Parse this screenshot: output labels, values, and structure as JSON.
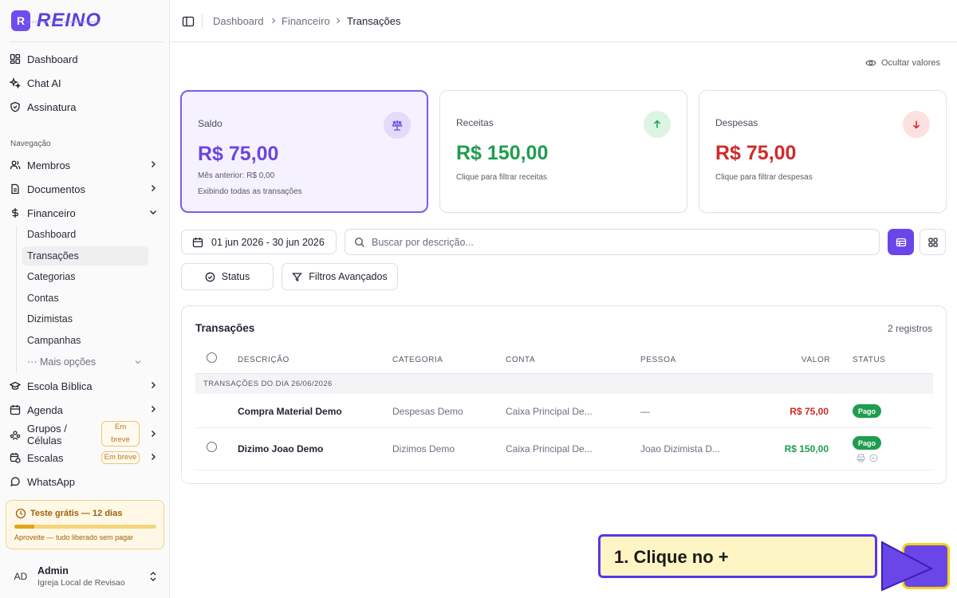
{
  "brand": {
    "name": "REINO",
    "tagline": "GESTÃO DE IGREJAS PARA PASTORES",
    "mark": "R"
  },
  "sidebar": {
    "top_items": [
      {
        "label": "Dashboard",
        "icon": "grid-icon"
      },
      {
        "label": "Chat AI",
        "icon": "sparkles-icon"
      },
      {
        "label": "Assinatura",
        "icon": "shield-icon"
      }
    ],
    "section_label": "Navegação",
    "items": [
      {
        "label": "Membros",
        "icon": "users-icon"
      },
      {
        "label": "Documentos",
        "icon": "file-icon"
      },
      {
        "label": "Financeiro",
        "icon": "dollar-icon"
      }
    ],
    "financeiro_sub": [
      "Dashboard",
      "Transações",
      "Categorias",
      "Contas",
      "Dizimistas",
      "Campanhas"
    ],
    "more_options": "··· Mais opções",
    "lower_items": [
      {
        "label": "Escola Bíblica",
        "icon": "graduation-cap-icon"
      },
      {
        "label": "Agenda",
        "icon": "calendar-icon"
      },
      {
        "label": "Grupos / Células",
        "icon": "group-icon",
        "badge": "Em breve"
      },
      {
        "label": "Escalas",
        "icon": "calendar-clock-icon",
        "badge": "Em breve"
      },
      {
        "label": "WhatsApp",
        "icon": "whatsapp-icon"
      }
    ],
    "trial": {
      "title": "Teste grátis — 12 dias",
      "note": "Aproveite — tudo liberado sem pagar",
      "progress": 0.14
    },
    "user": {
      "initials": "AD",
      "name": "Admin",
      "org": "Igreja Local de Revisao"
    }
  },
  "header": {
    "breadcrumb": [
      "Dashboard",
      "Financeiro",
      "Transações"
    ]
  },
  "hide_values_label": "Ocultar valores",
  "cards": {
    "saldo": {
      "label": "Saldo",
      "value": "R$ 75,00",
      "sub": "Mês anterior: R$ 0,00",
      "sub2": "Exibindo todas as transações"
    },
    "receitas": {
      "label": "Receitas",
      "value": "R$ 150,00",
      "sub": "Clique para filtrar receitas"
    },
    "despesas": {
      "label": "Despesas",
      "value": "R$ 75,00",
      "sub": "Clique para filtrar despesas"
    }
  },
  "filters": {
    "date_range": "01 jun 2026 - 30 jun 2026",
    "search_placeholder": "Buscar por descrição...",
    "status_label": "Status",
    "advanced_label": "Filtros Avançados"
  },
  "table": {
    "title": "Transações",
    "count": "2 registros",
    "columns": [
      "DESCRIÇÃO",
      "CATEGORIA",
      "CONTA",
      "PESSOA",
      "VALOR",
      "STATUS"
    ],
    "group_label": "TRANSAÇÕES DO DIA 26/06/2026",
    "rows": [
      {
        "descricao": "Compra Material Demo",
        "categoria": "Despesas Demo",
        "conta": "Caixa Principal De...",
        "pessoa": "—",
        "valor": "R$ 75,00",
        "status": "Pago",
        "type": "expense"
      },
      {
        "descricao": "Dizimo Joao Demo",
        "categoria": "Dizimos Demo",
        "conta": "Caixa Principal De...",
        "pessoa": "Joao Dizimista D...",
        "valor": "R$ 150,00",
        "status": "Pago",
        "type": "income"
      }
    ]
  },
  "tutorial": {
    "callout": "1. Clique no +"
  },
  "colors": {
    "accent": "#6a46e8",
    "income": "#1f9d4e",
    "expense": "#d12a2a",
    "saldo": "#6b45e0"
  }
}
